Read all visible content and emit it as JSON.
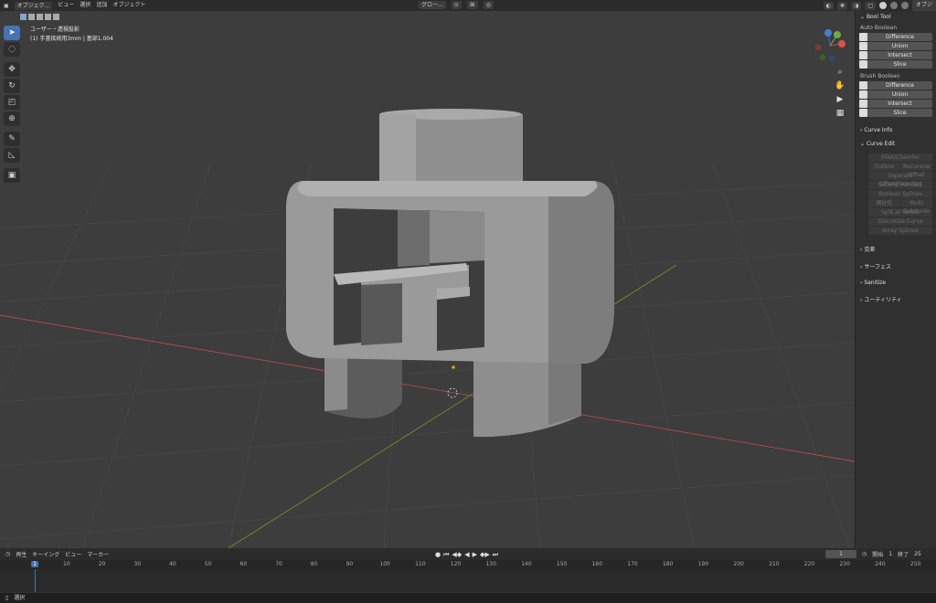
{
  "header": {
    "mode": "オブジェク...",
    "menus": [
      "ビュー",
      "選択",
      "追加",
      "オブジェクト"
    ],
    "transform_orientation": "グロー...",
    "right_tab": "オブジ"
  },
  "viewport": {
    "view_name": "ユーザー・透視投影",
    "object_info": "(1) 手書接続用3mm | 基部1.004"
  },
  "npanel": {
    "bool_tool": {
      "title": "Bool Tool",
      "auto_boolean": {
        "label": "Auto Boolean",
        "buttons": [
          "Difference",
          "Union",
          "Intersect",
          "Slice"
        ]
      },
      "brush_boolean": {
        "label": "Brush Boolean",
        "buttons": [
          "Difference",
          "Union",
          "Intersect",
          "Slice"
        ]
      }
    },
    "curve_info": "Curve Info",
    "curve_edit": {
      "title": "Curve Edit",
      "items": [
        "Fillet/Chamfer"
      ],
      "pair": [
        "Outline",
        "Recursive Offset"
      ],
      "items2": [
        "Separate Offset/Selected",
        "Extend Handles",
        "Boolean Splines"
      ],
      "pair2": [
        "細分化",
        "Multi Subdivide"
      ],
      "items3": [
        "Split at Vertex",
        "Discretize Curve",
        "Array Splines"
      ]
    },
    "folds": [
      "交差",
      "サーフェス",
      "Sanitize",
      "ユーティリティ"
    ]
  },
  "timeline": {
    "menus": [
      "再生",
      "キーイング",
      "ビュー",
      "マーカー"
    ],
    "current_frame": "1",
    "start_label": "開始",
    "start": "1",
    "end_label": "終了",
    "end": "25",
    "ruler": [
      "1",
      "10",
      "20",
      "30",
      "40",
      "50",
      "60",
      "70",
      "80",
      "90",
      "100",
      "110",
      "120",
      "130",
      "140",
      "150",
      "160",
      "170",
      "180",
      "190",
      "200",
      "210",
      "220",
      "230",
      "240",
      "250"
    ]
  },
  "status": {
    "left": "選択"
  },
  "colors": {
    "accent": "#4772b3",
    "x_axis": "#b24b4b",
    "y_axis": "#6e8f2f",
    "viewport_bg": "#3d3d3d"
  }
}
